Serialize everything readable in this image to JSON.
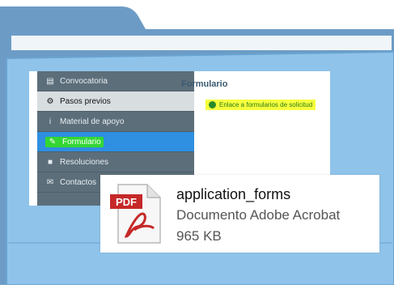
{
  "sidebar": {
    "items": [
      {
        "label": "Convocatoria",
        "icon": "document-icon"
      },
      {
        "label": "Pasos previos",
        "icon": "gear-icon"
      },
      {
        "label": "Material de apoyo",
        "icon": "info-icon"
      },
      {
        "label": "Formulario",
        "icon": "pencil-icon"
      },
      {
        "label": "Resoluciones",
        "icon": "lock-icon"
      },
      {
        "label": "Contactos",
        "icon": "envelope-icon"
      }
    ]
  },
  "content": {
    "title": "Formulario",
    "link_label": "Enlace a formularios de solicitud"
  },
  "file": {
    "badge": "PDF",
    "name": "application_forms",
    "type": "Documento Adobe Acrobat",
    "size": "965 KB"
  },
  "colors": {
    "folder": "#8fc3ea",
    "sidebar": "#5c6e7a",
    "active": "#2f8fe0",
    "highlight": "#f6ff3c",
    "pdf_red": "#c62828"
  }
}
